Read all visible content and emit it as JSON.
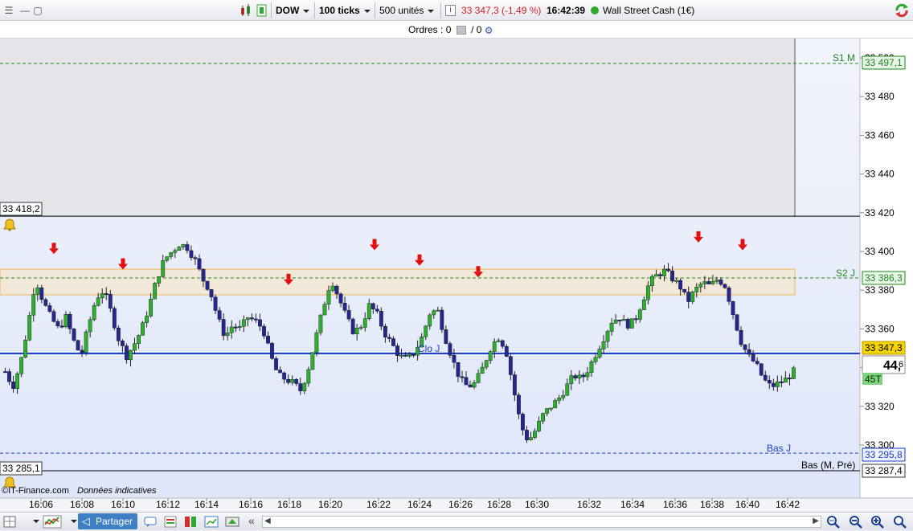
{
  "toolbar": {
    "instrument": "DOW",
    "timeframe": "100 ticks",
    "units": "500 unités",
    "quote": "33 347,3 (-1,49 %)",
    "time": "16:42:39",
    "market_name": "Wall Street Cash (1€)",
    "colors": {
      "quote_red": "#d22020",
      "status_green": "#2ea82e"
    }
  },
  "orders": {
    "label": "Ordres :",
    "count_a": "0",
    "slash": "/",
    "count_b": "0"
  },
  "levels": {
    "s1m_label": "S1 M",
    "s1m_value": "33 497,1",
    "s2j_label": "S2 J",
    "s2j_value": "33 386,3",
    "clo_label": "Clo J",
    "current_value": "33 347,3",
    "bas_j_label": "Bas J",
    "bas_j_value": "33 295,8",
    "bas_mpre_label": "Bas (M, Pré)",
    "bas_mpre_value": "33 287,4",
    "alert_top_value": "33 418,2",
    "alert_bottom_value": "33 285,1",
    "countdown_main": "44,",
    "countdown_small": "6",
    "ticks_badge": "45T"
  },
  "y_axis": {
    "ticks": [
      "33 500",
      "33 480",
      "33 460",
      "33 440",
      "33 420",
      "33 400",
      "33 380",
      "33 360",
      "33 340",
      "33 320",
      "33 300"
    ],
    "tick_values": [
      33500,
      33480,
      33460,
      33440,
      33420,
      33400,
      33380,
      33360,
      33340,
      33320,
      33300
    ]
  },
  "x_axis": {
    "ticks": [
      "16:06",
      "16:08",
      "16:10",
      "16:12",
      "16:14",
      "16:16",
      "16:18",
      "16:20",
      "16:22",
      "16:24",
      "16:26",
      "16:28",
      "16:30",
      "16:32",
      "16:34",
      "16:36",
      "16:38",
      "16:40",
      "16:42"
    ]
  },
  "footer": {
    "copyright": "©IT-Finance.com",
    "note": "Données indicatives"
  },
  "bottom_toolbar": {
    "share_label": "Partager",
    "nav_prev": "«"
  },
  "chart_data": {
    "type": "candlestick",
    "close_path": [
      33338,
      33330,
      33342,
      33362,
      33386,
      33374,
      33366,
      33360,
      33366,
      33354,
      33346,
      33362,
      33376,
      33380,
      33368,
      33354,
      33346,
      33352,
      33360,
      33372,
      33386,
      33396,
      33400,
      33404,
      33402,
      33396,
      33386,
      33380,
      33366,
      33356,
      33362,
      33360,
      33366,
      33364,
      33360,
      33346,
      33336,
      33334,
      33332,
      33328,
      33340,
      33356,
      33372,
      33386,
      33376,
      33366,
      33358,
      33362,
      33372,
      33368,
      33358,
      33352,
      33346,
      33344,
      33348,
      33356,
      33368,
      33370,
      33356,
      33344,
      33334,
      33330,
      33332,
      33340,
      33350,
      33356,
      33350,
      33330,
      33310,
      33302,
      33308,
      33316,
      33320,
      33324,
      33330,
      33336,
      33334,
      33340,
      33348,
      33356,
      33364,
      33366,
      33362,
      33364,
      33374,
      33384,
      33388,
      33390,
      33386,
      33382,
      33374,
      33380,
      33384,
      33382,
      33386,
      33382,
      33368,
      33354,
      33346,
      33342,
      33334,
      33330,
      33332,
      33334,
      33338
    ],
    "ylim": [
      33285,
      33510
    ],
    "levels": {
      "S1 M": 33497.1,
      "S2 J": 33386.3,
      "Clo J": 33347.3,
      "Bas J": 33295.8,
      "Bas (M, Pré)": 33287.4,
      "alert_top": 33418.2,
      "alert_bottom": 33285.1
    },
    "marker_prices": [
      33392,
      33384,
      33376,
      33394,
      33386,
      33380,
      33398,
      33394
    ],
    "colors": {
      "up": "#2fae2f",
      "down": "#26268f",
      "marker": "#e01010",
      "level_green": "#1f8a1f",
      "level_blue": "#1a3fc8"
    }
  }
}
